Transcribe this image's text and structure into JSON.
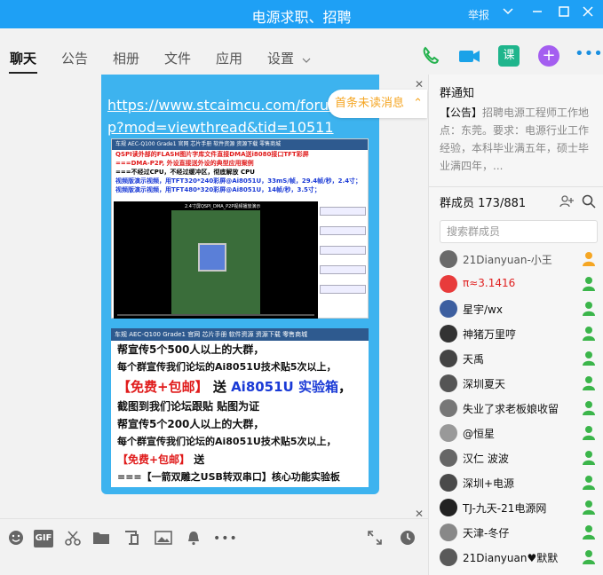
{
  "window": {
    "title": "电源求职、招聘",
    "report_label": "举报"
  },
  "tabs": [
    "聊天",
    "公告",
    "相册",
    "文件",
    "应用",
    "设置"
  ],
  "chat": {
    "link_text": "https://www.stcaimcu.com/forum.php?mod=viewthread&tid=10511",
    "unread_label": "首条未读消息",
    "image1": {
      "nav": "车规 AEC-Q100 Grade1  官网  芯片手册  软件资源  资源下载  零售商城",
      "lines": [
        "QSPI读外部的FLASH图片字库文件直接DMA送i8080接口TFT彩屏",
        "===DMA-P2P, 外设直接送外设的典型应用案例",
        "===不经过CPU，不经过缓冲区，彻底解放 CPU",
        "视频版演示视频，用TFT320*240彩屏@Ai8051U，33mS/帧，29.4帧/秒，2.4寸；",
        "视频版演示视频，用TFT480*320彩屏@Ai8051U，14帧/秒，3.5寸；"
      ],
      "video_caption": "2.4寸屏QSPI_DMA_P2P视频播放演示"
    },
    "image2": {
      "nav": "车规 AEC-Q100 Grade1  官网  芯片手册  软件资源  资源下载  零售商城",
      "line1": "帮宣传5个500人以上的大群，",
      "line2": "每个群宣传我们论坛的Ai8051U技术贴5次以上，",
      "free": "【免费+包邮】",
      "send": "送",
      "kit": "Ai8051U 实验箱",
      "line4": "截图到我们论坛跟贴 贴图为证",
      "line5": "帮宣传5个200人以上的大群，",
      "line6": "每个群宣传我们论坛的Ai8051U技术贴5次以上，",
      "free2": "【免费+包邮】",
      "send2": "送",
      "line8": "===【一箭双雕之USB转双串口】核心功能实验板"
    }
  },
  "right": {
    "notice_title": "群通知",
    "notice_tag": "【公告】",
    "notice_body": "招聘电源工程师工作地点：东莞。要求：电源行业工作经验，本科毕业满五年，硕士毕业满四年，...",
    "members_title": "群成员 173/881",
    "search_placeholder": "搜索群成员",
    "members": [
      {
        "name": "21Dianyuan-小王",
        "color": "#555555"
      },
      {
        "name": "π≈3.1416",
        "color": "#e02020"
      },
      {
        "name": "星宇/wx",
        "color": "#111111"
      },
      {
        "name": "神猪万里哼",
        "color": "#111111"
      },
      {
        "name": "天禹",
        "color": "#111111"
      },
      {
        "name": "深圳夏天",
        "color": "#111111"
      },
      {
        "name": "失业了求老板娘收留",
        "color": "#111111"
      },
      {
        "name": "@恒星",
        "color": "#111111"
      },
      {
        "name": "汉仁 波波",
        "color": "#111111"
      },
      {
        "name": "深圳+电源",
        "color": "#111111"
      },
      {
        "name": "TJ-九天-21电源网",
        "color": "#111111"
      },
      {
        "name": "天津-冬仔",
        "color": "#111111"
      },
      {
        "name": "21Dianyuan♥默默",
        "color": "#111111"
      }
    ]
  }
}
